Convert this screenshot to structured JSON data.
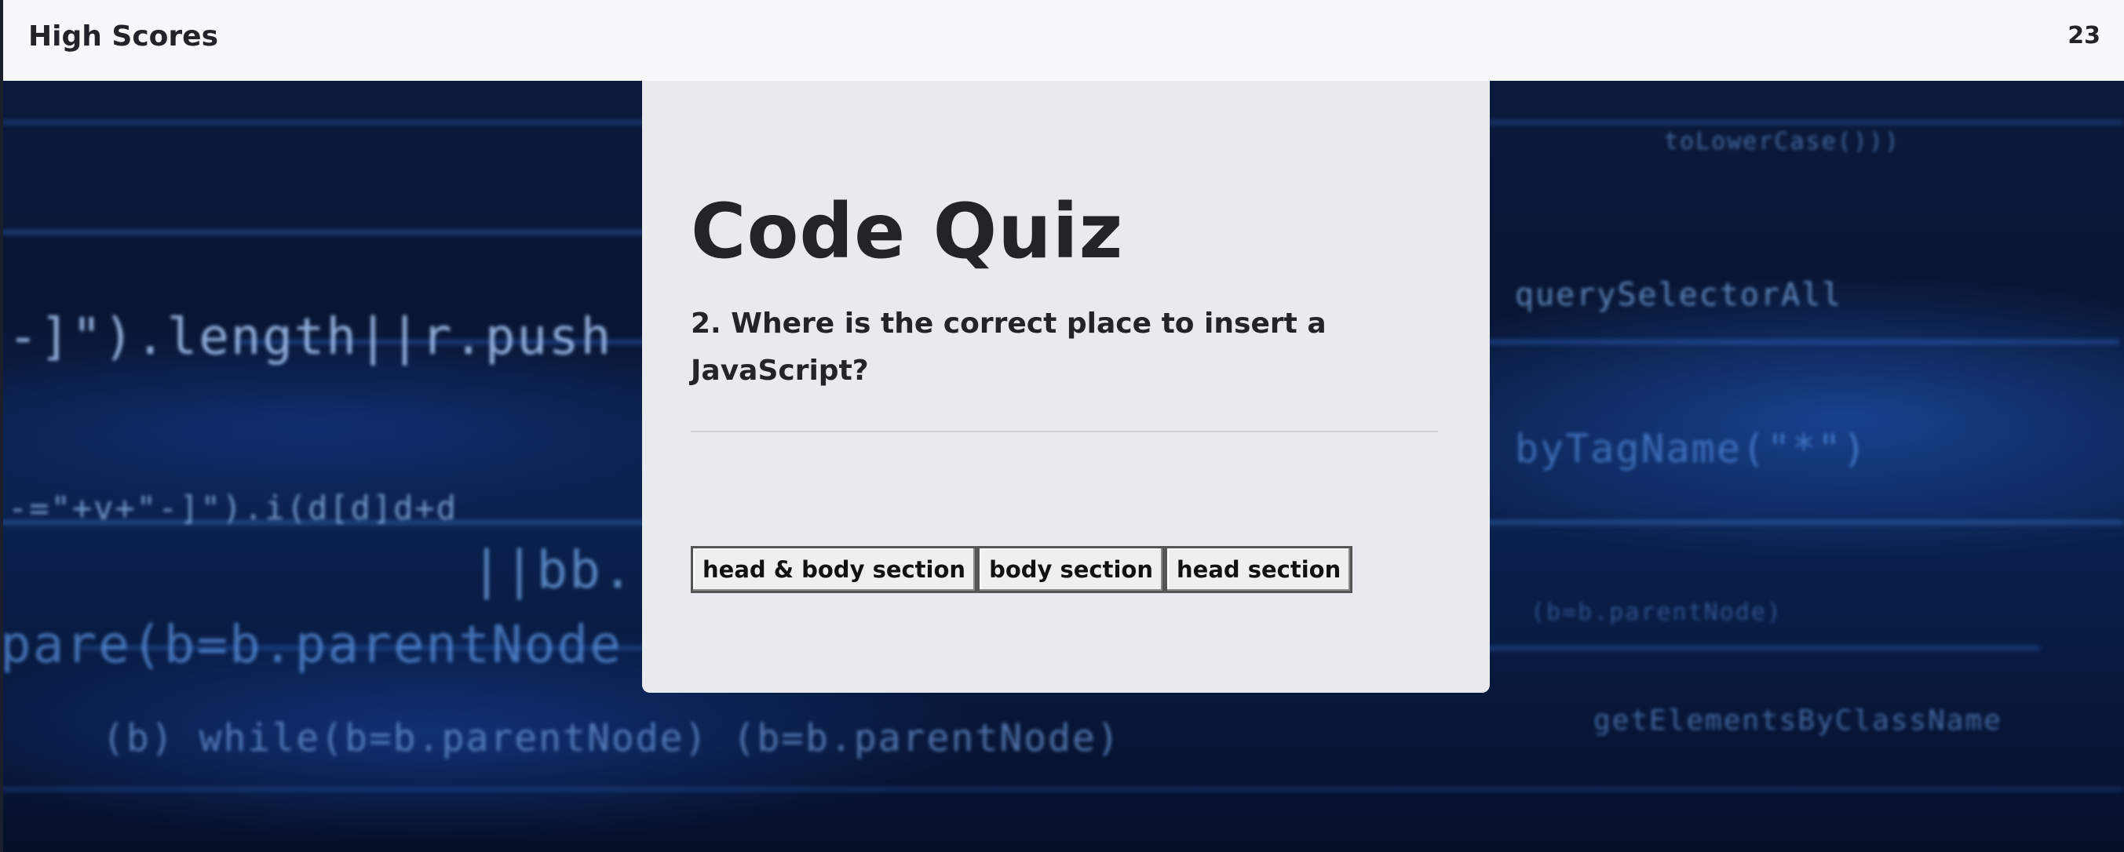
{
  "header": {
    "high_scores_label": "High Scores",
    "timer_value": "23"
  },
  "quiz": {
    "title": "Code Quiz",
    "question": "2. Where is the correct place to insert a JavaScript?",
    "answers": [
      "head & body section",
      "body section",
      "head section"
    ]
  },
  "background": {
    "code_fragments": [
      "-]\").length||r.push",
      "-=\"+v+\"-]\").i(d[d]d+d",
      "||bb.",
      "pare(b=b.parentNode",
      "(b) while(b=b.parentNode) (b=b.parentNode)",
      "toLowerCase()))",
      "(b=b.parentNode)",
      "byTagName(\"*\")",
      "getElementsByClassName",
      "querySelectorAll"
    ]
  },
  "colors": {
    "topbar_bg": "#f7f8fa",
    "card_bg": "#e9eaee",
    "text_dark": "#212529",
    "background_blue": "#0b2250"
  }
}
